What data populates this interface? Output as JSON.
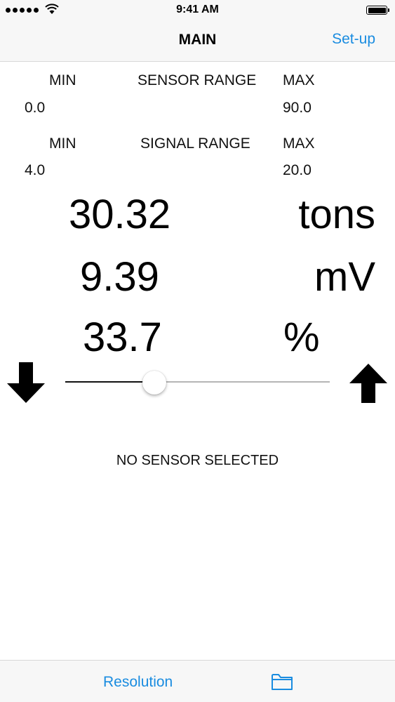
{
  "status_bar": {
    "time": "9:41 AM",
    "signal_icon": "cellular-signal-icon",
    "wifi_icon": "wifi-icon",
    "battery_icon": "battery-icon"
  },
  "nav": {
    "title": "MAIN",
    "setup_label": "Set-up"
  },
  "sensor_range": {
    "title": "SENSOR RANGE",
    "min_label": "MIN",
    "max_label": "MAX",
    "min_value": "0.0",
    "max_value": "90.0"
  },
  "signal_range": {
    "title": "SIGNAL RANGE",
    "min_label": "MIN",
    "max_label": "MAX",
    "min_value": "4.0",
    "max_value": "20.0"
  },
  "readings": {
    "engineering_value": "30.32",
    "engineering_unit": "tons",
    "signal_value": "9.39",
    "signal_unit": "mV",
    "percent_value": "33.7",
    "percent_unit": "%"
  },
  "slider": {
    "fraction": 0.337,
    "decrease_icon": "arrow-down-icon",
    "increase_icon": "arrow-up-icon"
  },
  "status_message": "NO SENSOR SELECTED",
  "tab_bar": {
    "resolution_label": "Resolution",
    "folder_icon": "folder-icon"
  },
  "colors": {
    "accent": "#1a8ce0",
    "bar_background": "#f7f7f7"
  }
}
